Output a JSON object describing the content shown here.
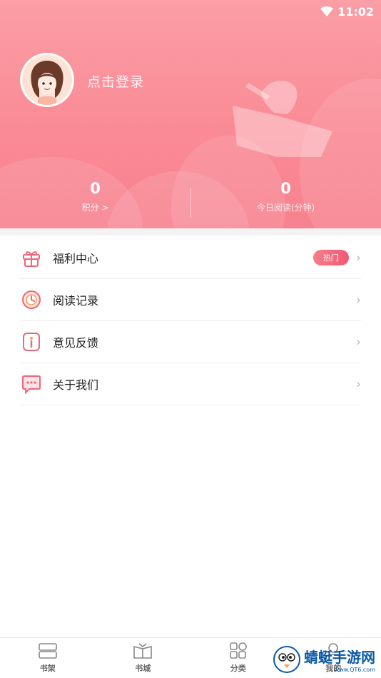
{
  "status_bar": {
    "time": "11:02"
  },
  "profile": {
    "login_text": "点击登录"
  },
  "stats": [
    {
      "value": "0",
      "label": "积分 >"
    },
    {
      "value": "0",
      "label": "今日阅读(分钟)"
    }
  ],
  "menu": [
    {
      "label": "福利中心",
      "badge": "热门",
      "icon": "gift-icon"
    },
    {
      "label": "阅读记录",
      "icon": "clock-icon"
    },
    {
      "label": "意见反馈",
      "icon": "info-icon"
    },
    {
      "label": "关于我们",
      "icon": "chat-icon"
    }
  ],
  "tabbar": [
    {
      "label": "书架",
      "icon": "bookshelf-icon"
    },
    {
      "label": "书城",
      "icon": "bookstore-icon"
    },
    {
      "label": "分类",
      "icon": "category-icon"
    },
    {
      "label": "我的",
      "icon": "profile-icon"
    }
  ],
  "watermark": {
    "text": "蜻蜓手游网",
    "sub": "www.QT6.com"
  },
  "colors": {
    "header": "#fa8b96",
    "accent": "#f05a74"
  }
}
